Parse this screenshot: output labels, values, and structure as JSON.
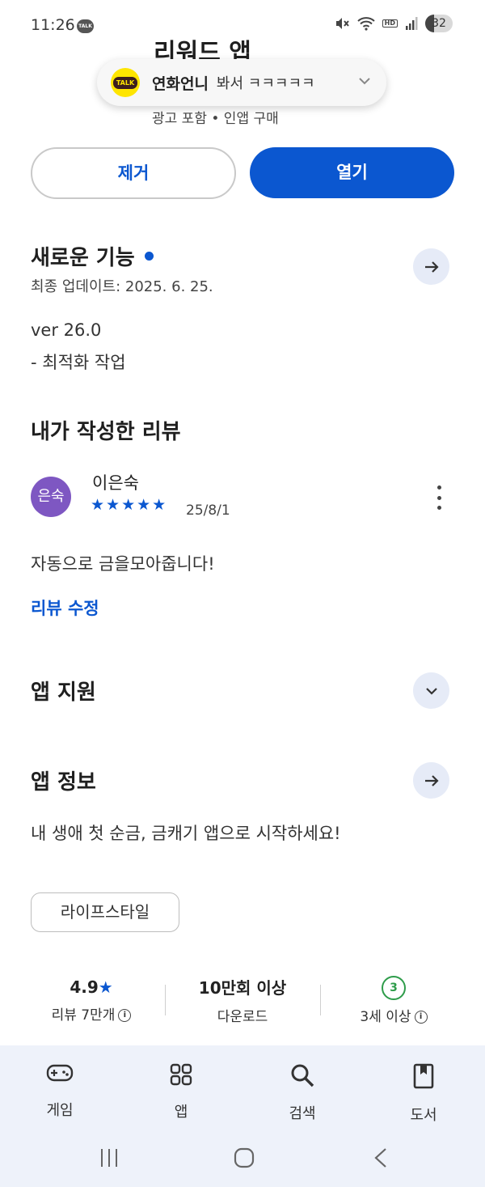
{
  "status": {
    "time": "11:26",
    "talk_badge": "TALK",
    "hd_label": "HD",
    "battery": "32"
  },
  "app": {
    "title": "리워드 앱",
    "sub_info": "광고 포함 • 인앱 구매"
  },
  "notification": {
    "app_badge": "TALK",
    "sender": "연화언니",
    "message": "봐서 ㅋㅋㅋㅋㅋ"
  },
  "actions": {
    "remove_label": "제거",
    "open_label": "열기"
  },
  "whats_new": {
    "title": "새로운 기능",
    "last_updated": "최종 업데이트: 2025. 6. 25.",
    "version": "ver 26.0",
    "note": "- 최적화 작업"
  },
  "my_review": {
    "title": "내가 작성한 리뷰",
    "avatar_text": "은숙",
    "reviewer": "이은숙",
    "stars_text": "★★★★★",
    "rating": 5,
    "date": "25/8/1",
    "text": "자동으로 금을모아줍니다!",
    "edit_label": "리뷰 수정"
  },
  "app_support": {
    "title": "앱 지원"
  },
  "app_info": {
    "title": "앱 정보",
    "description": "내 생애 첫 순금, 금캐기 앱으로 시작하세요!",
    "category": "라이프스타일"
  },
  "stats": {
    "rating": {
      "value": "4.9",
      "star": "★",
      "label": "리뷰 7만개"
    },
    "downloads": {
      "value": "10만회 이상",
      "label": "다운로드"
    },
    "age": {
      "value": "3",
      "label": "3세 이상"
    },
    "info_glyph": "i"
  },
  "bottom_nav": [
    {
      "label": "게임",
      "icon": "gamepad-icon"
    },
    {
      "label": "앱",
      "icon": "apps-grid-icon"
    },
    {
      "label": "검색",
      "icon": "search-icon"
    },
    {
      "label": "도서",
      "icon": "book-icon"
    }
  ],
  "colors": {
    "accent": "#0b57d0",
    "avatar": "#7e57c2",
    "age_green": "#2e9c4a",
    "nav_bg": "#eef2fa"
  }
}
